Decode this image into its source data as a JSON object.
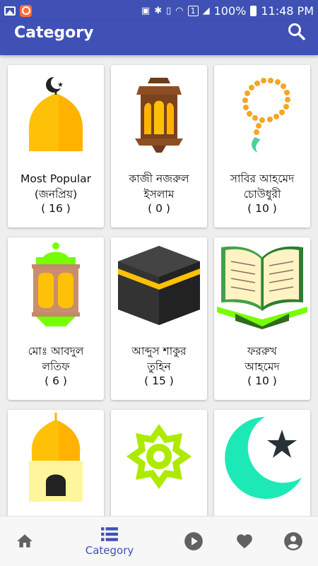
{
  "status_bar": {
    "sim_badge": "1",
    "battery": "100%",
    "time": "11:48 PM"
  },
  "app_bar": {
    "title": "Category",
    "search_icon": "search-icon"
  },
  "colors": {
    "primary": "#3f51b5",
    "icon_inactive": "#616161"
  },
  "categories": [
    {
      "name_line1": "Most Popular",
      "name_line2": "(জনপ্রিয়)",
      "count": "( 16 )",
      "icon": "mosque-dome-icon"
    },
    {
      "name_line1": "কাজী নজরুল",
      "name_line2": "ইসলাম",
      "count": "( 0 )",
      "icon": "lantern-icon"
    },
    {
      "name_line1": "সাবির আহমেদ",
      "name_line2": "চোউধুরী",
      "count": "( 10 )",
      "icon": "prayer-beads-icon"
    },
    {
      "name_line1": "মোঃ আবদুল",
      "name_line2": "লতিফ",
      "count": "( 6 )",
      "icon": "green-lantern-icon"
    },
    {
      "name_line1": "আব্দুস শাকুর",
      "name_line2": "তুহিন",
      "count": "( 15 )",
      "icon": "kaaba-icon"
    },
    {
      "name_line1": "ফররুখ",
      "name_line2": "আহমেদ",
      "count": "( 10 )",
      "icon": "quran-icon"
    },
    {
      "name_line1": "",
      "name_line2": "",
      "count": "",
      "icon": "mosque-building-icon"
    },
    {
      "name_line1": "",
      "name_line2": "",
      "count": "",
      "icon": "star-pattern-icon"
    },
    {
      "name_line1": "",
      "name_line2": "",
      "count": "",
      "icon": "crescent-star-icon"
    }
  ],
  "bottom_nav": {
    "home_icon": "home-icon",
    "category_label": "Category",
    "play_icon": "play-icon",
    "favorite_icon": "heart-icon",
    "account_icon": "account-icon"
  }
}
